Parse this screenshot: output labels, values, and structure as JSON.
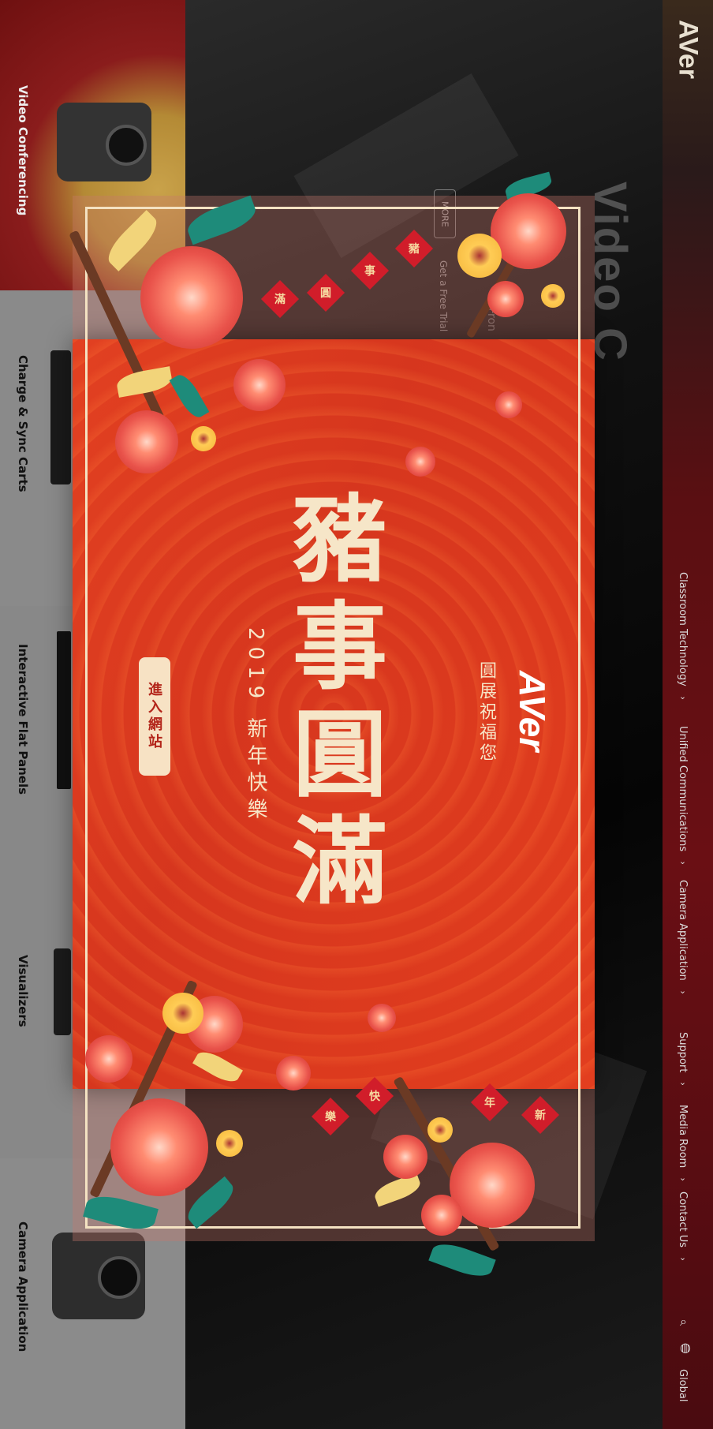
{
  "nav": {
    "logo": "AVer",
    "items": [
      {
        "label": "Classroom Technology"
      },
      {
        "label": "Unified Communications"
      },
      {
        "label": "Camera Application"
      },
      {
        "label": "Support"
      },
      {
        "label": "Media Room"
      },
      {
        "label": "Contact Us"
      }
    ],
    "chevron": "⌄",
    "search_icon": "search-icon",
    "globe_icon": "globe-icon",
    "global_label": "Global"
  },
  "hero": {
    "title": "Video C",
    "subtitle": "Fron",
    "more_label": "MORE",
    "trial_label": "Get a Free Trial"
  },
  "products": [
    {
      "label": "Video Conferencing"
    },
    {
      "label": "Charge & Sync Carts"
    },
    {
      "label": "Interactive Flat Panels"
    },
    {
      "label": "Visualizers"
    },
    {
      "label": "Camera Application"
    }
  ],
  "modal": {
    "brand": "AVer",
    "brand_sub": "圓展祝福您",
    "slogan": "豬事圓滿",
    "year_greeting": "2019 新年快樂",
    "enter_label": "進入網站",
    "tags_top": [
      "豬",
      "事",
      "圓",
      "滿"
    ],
    "tags_bottom": [
      "新",
      "年",
      "快",
      "樂"
    ]
  }
}
